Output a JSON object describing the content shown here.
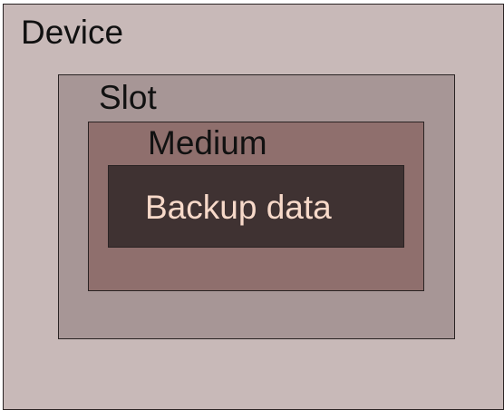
{
  "diagram": {
    "device": {
      "label": "Device",
      "color": "#c8b9b8"
    },
    "slot": {
      "label": "Slot",
      "color": "#a79696"
    },
    "medium": {
      "label": "Medium",
      "color": "#8f6f6d"
    },
    "backup_data": {
      "label": "Backup data",
      "color": "#3f3232",
      "text_color": "#f7d9c9"
    }
  }
}
